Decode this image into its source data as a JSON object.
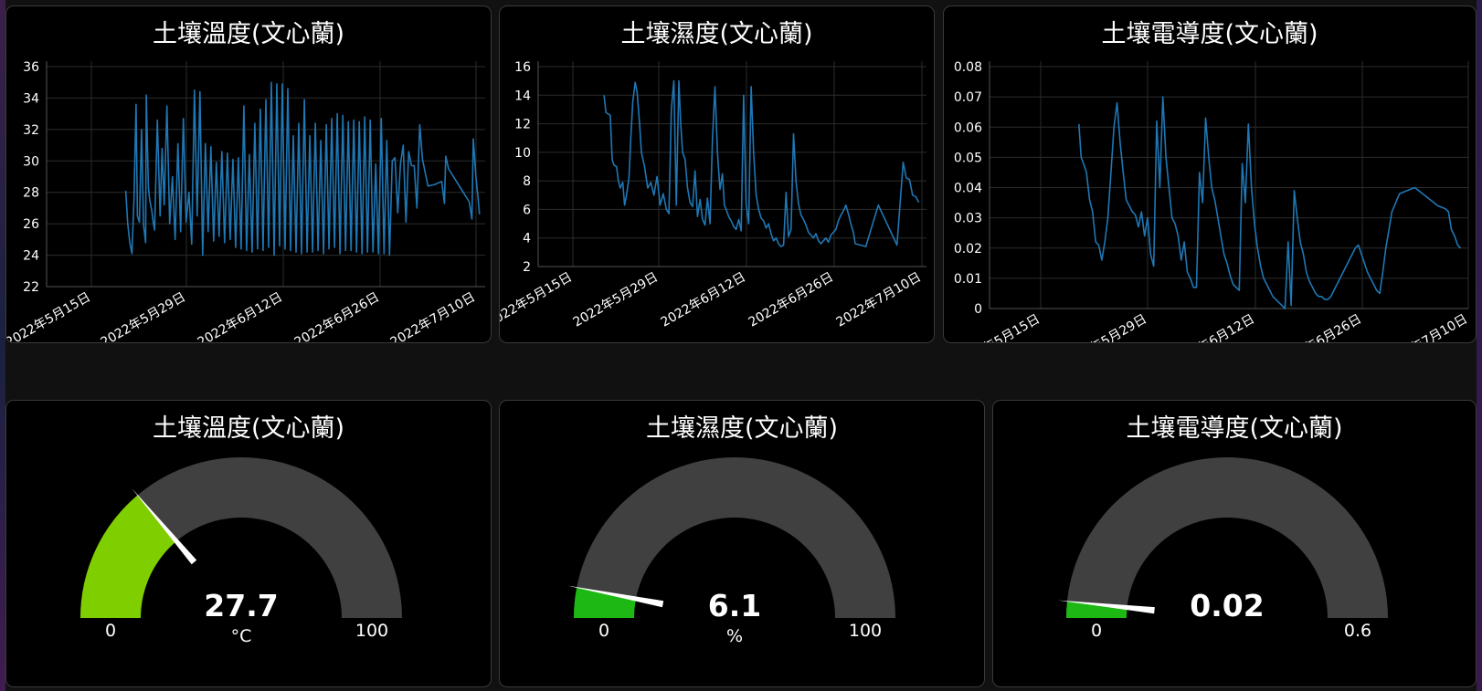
{
  "charts": [
    {
      "title": "土壤溫度(文心蘭)",
      "chart_data": {
        "type": "line",
        "x_start": "2022-05-20",
        "x_ticks": [
          "2022年5月15日",
          "2022年5月29日",
          "2022年6月12日",
          "2022年6月26日",
          "2022年7月10日"
        ],
        "y_ticks": [
          "22",
          "24",
          "26",
          "28",
          "30",
          "32",
          "34",
          "36"
        ],
        "ylim": [
          22,
          36
        ],
        "xlabel": "",
        "ylabel": "",
        "line_color": "#1f77b4",
        "series": [
          {
            "x": [
              0.0,
              0.3,
              0.6,
              0.9,
              1.2,
              1.5,
              1.7,
              2.0,
              2.3,
              2.6,
              2.9,
              3.0,
              3.3,
              3.5,
              3.8,
              4.0,
              4.2,
              4.6,
              5.0,
              5.3,
              5.6,
              6.0,
              6.4,
              6.8,
              7.2,
              7.6,
              8.0,
              8.4,
              8.8,
              9.2,
              9.6,
              10.0,
              10.4,
              10.8,
              11.2,
              11.6,
              12.0,
              12.4,
              12.8,
              13.2,
              13.6,
              14.0,
              14.4,
              14.8,
              15.2,
              15.6,
              16.0,
              16.4,
              16.8,
              17.2,
              17.6,
              18.0,
              18.4,
              18.8,
              19.2,
              19.6,
              20.0,
              20.4,
              20.8,
              21.2,
              21.6,
              22.0,
              22.4,
              22.8,
              23.2,
              23.6,
              24.0,
              24.4,
              24.8,
              25.2,
              25.6,
              26.0,
              26.4,
              26.8,
              27.2,
              27.6,
              28.0,
              28.4,
              28.8,
              29.2,
              29.6,
              30.0,
              30.4,
              30.8,
              31.2,
              31.6,
              32.0,
              32.4,
              32.8,
              33.2,
              33.6,
              34.0,
              34.4,
              34.8,
              35.2,
              35.6,
              36.0,
              36.4,
              36.8,
              37.2,
              37.6,
              38.0,
              38.4,
              38.8,
              39.2,
              39.6,
              40.0,
              40.4,
              40.8,
              41.2,
              41.6,
              42.0,
              42.4,
              42.8,
              43.2,
              44.0,
              45.0,
              46.0,
              46.4,
              46.6,
              47.0,
              50.0,
              50.4,
              50.6,
              51.0,
              51.3,
              51.5
            ],
            "values": [
              28.1,
              26.0,
              24.8,
              24.1,
              27.5,
              33.6,
              26.5,
              26.1,
              32.0,
              25.9,
              24.8,
              34.2,
              28.3,
              27.5,
              26.8,
              26.1,
              25.6,
              32.6,
              26.5,
              30.8,
              27.2,
              33.5,
              26.0,
              29.0,
              25.0,
              31.1,
              25.5,
              32.7,
              26.1,
              28.0,
              24.7,
              34.5,
              26.5,
              34.4,
              24.0,
              31.1,
              25.5,
              30.9,
              24.9,
              29.9,
              25.2,
              30.6,
              24.8,
              30.5,
              25.0,
              30.1,
              24.5,
              30.2,
              24.4,
              33.5,
              24.3,
              30.4,
              24.2,
              32.4,
              24.4,
              33.3,
              24.3,
              33.9,
              24.5,
              35.0,
              24.0,
              34.9,
              24.6,
              34.9,
              24.4,
              34.6,
              24.3,
              31.6,
              24.2,
              32.4,
              24.1,
              33.9,
              24.2,
              31.6,
              24.2,
              32.4,
              24.3,
              31.3,
              24.1,
              32.3,
              24.4,
              32.7,
              24.5,
              33.0,
              24.1,
              32.9,
              24.3,
              32.5,
              24.3,
              32.6,
              24.2,
              32.5,
              24.1,
              32.8,
              24.2,
              32.6,
              24.2,
              29.8,
              24.1,
              32.7,
              24.1,
              31.3,
              24.0,
              30.0,
              30.2,
              26.7,
              29.8,
              31.0,
              26.1,
              30.6,
              29.7,
              29.7,
              27.0,
              32.3,
              30.1,
              28.4,
              28.5,
              28.7,
              27.3,
              30.3,
              29.5,
              27.4,
              26.3,
              31.4,
              28.9,
              27.6,
              26.6
            ]
          }
        ]
      }
    },
    {
      "title": "土壤濕度(文心蘭)",
      "chart_data": {
        "type": "line",
        "x_start": "2022-05-20",
        "x_ticks": [
          "2022年5月15日",
          "2022年5月29日",
          "2022年6月12日",
          "2022年6月26日",
          "2022年7月10日"
        ],
        "y_ticks": [
          "2",
          "4",
          "6",
          "8",
          "10",
          "12",
          "14",
          "16"
        ],
        "ylim": [
          2,
          16
        ],
        "xlabel": "",
        "ylabel": "",
        "line_color": "#1f77b4",
        "series": [
          {
            "x": [
              0.0,
              0.3,
              0.6,
              1.0,
              1.3,
              1.6,
              2.0,
              2.3,
              2.6,
              3.0,
              3.3,
              3.6,
              4.0,
              4.3,
              4.6,
              5.0,
              5.3,
              5.7,
              6.0,
              6.5,
              7.0,
              7.5,
              8.0,
              8.5,
              9.0,
              9.5,
              10.0,
              10.4,
              10.8,
              11.2,
              11.6,
              12.0,
              12.3,
              12.6,
              13.0,
              13.4,
              13.8,
              14.2,
              14.6,
              15.0,
              15.4,
              15.8,
              16.2,
              16.6,
              17.0,
              17.4,
              17.8,
              18.2,
              18.6,
              19.0,
              19.3,
              19.6,
              20.0,
              20.4,
              20.8,
              21.2,
              21.6,
              22.0,
              22.4,
              22.8,
              23.2,
              23.6,
              24.0,
              24.4,
              24.8,
              25.2,
              25.6,
              26.0,
              26.4,
              26.8,
              27.2,
              27.6,
              28.0,
              28.4,
              28.8,
              29.2,
              29.6,
              30.0,
              30.4,
              30.8,
              31.2,
              31.6,
              32.0,
              32.4,
              32.8,
              33.2,
              33.6,
              34.0,
              34.4,
              34.8,
              35.2,
              35.6,
              36.0,
              36.4,
              36.8,
              37.2,
              37.6,
              38.0,
              38.4,
              38.8,
              39.2,
              39.6,
              40.0,
              40.3,
              42.0,
              44.0,
              47.0,
              48.0,
              48.5,
              49.0,
              49.5,
              50.0,
              50.5
            ],
            "values": [
              14.0,
              12.8,
              12.7,
              12.6,
              9.5,
              9.1,
              9.0,
              8.0,
              7.5,
              7.9,
              6.3,
              7.0,
              8.2,
              11.0,
              13.5,
              14.9,
              14.2,
              12.0,
              10.0,
              9.0,
              7.5,
              7.9,
              7.0,
              8.3,
              6.3,
              7.1,
              6.0,
              5.7,
              13.0,
              15.0,
              6.3,
              15.0,
              12.0,
              10.0,
              9.5,
              7.5,
              6.5,
              6.2,
              8.7,
              5.5,
              6.7,
              5.3,
              4.9,
              6.8,
              5.0,
              11.0,
              14.6,
              9.9,
              7.4,
              8.5,
              6.3,
              6.0,
              5.5,
              5.2,
              4.8,
              4.6,
              5.3,
              4.5,
              14.0,
              6.4,
              5.0,
              14.6,
              10.0,
              7.0,
              6.0,
              5.4,
              5.2,
              4.7,
              5.0,
              4.3,
              3.8,
              4.0,
              3.6,
              3.4,
              3.5,
              7.2,
              4.1,
              4.6,
              11.3,
              8.0,
              6.4,
              5.6,
              5.3,
              4.9,
              4.4,
              4.2,
              4.0,
              4.3,
              3.8,
              3.6,
              3.8,
              4.0,
              3.7,
              4.2,
              4.4,
              4.6,
              5.2,
              5.6,
              5.9,
              6.3,
              5.7,
              5.0,
              4.4,
              3.6,
              3.4,
              6.3,
              3.5,
              9.3,
              8.2,
              8.1,
              7.0,
              6.9,
              6.5,
              6.3
            ]
          }
        ]
      }
    },
    {
      "title": "土壤電導度(文心蘭)",
      "chart_data": {
        "type": "line",
        "x_start": "2022-05-20",
        "x_ticks": [
          "2022年5月15日",
          "2022年5月29日",
          "2022年6月12日",
          "2022年6月26日",
          "2022年7月10日"
        ],
        "y_ticks": [
          "0",
          "0.01",
          "0.02",
          "0.03",
          "0.04",
          "0.05",
          "0.06",
          "0.07",
          "0.08"
        ],
        "ylim": [
          0,
          0.08
        ],
        "xlabel": "",
        "ylabel": "",
        "line_color": "#1f77b4",
        "series": [
          {
            "x": [
              0.0,
              0.3,
              0.6,
              1.0,
              1.4,
              1.8,
              2.2,
              2.6,
              3.0,
              3.4,
              3.8,
              4.2,
              4.6,
              5.0,
              5.4,
              5.8,
              6.2,
              6.6,
              7.0,
              7.4,
              7.8,
              8.2,
              8.6,
              9.0,
              9.4,
              9.8,
              10.2,
              10.6,
              11.0,
              11.4,
              11.8,
              12.2,
              12.6,
              13.0,
              13.4,
              13.8,
              14.2,
              14.6,
              15.0,
              15.4,
              15.8,
              16.2,
              16.6,
              17.0,
              17.4,
              17.8,
              18.2,
              18.6,
              19.0,
              19.4,
              19.8,
              20.2,
              20.6,
              21.0,
              21.4,
              21.8,
              22.2,
              22.6,
              23.0,
              23.4,
              23.8,
              24.2,
              24.6,
              25.0,
              25.4,
              25.8,
              26.2,
              26.6,
              27.0,
              27.4,
              27.8,
              28.2,
              28.6,
              29.0,
              29.4,
              29.8,
              30.2,
              30.6,
              31.0,
              31.4,
              31.8,
              32.2,
              32.6,
              33.0,
              33.4,
              33.8,
              34.2,
              34.6,
              35.0,
              35.4,
              35.8,
              36.2,
              36.6,
              37.0,
              37.4,
              37.8,
              38.2,
              38.6,
              39.0,
              39.4,
              39.8,
              40.2,
              40.6,
              41.0,
              42.0,
              44.0,
              47.0,
              48.0,
              48.4,
              48.8,
              49.2,
              49.6,
              50.0,
              50.4
            ],
            "values": [
              0.061,
              0.05,
              0.048,
              0.045,
              0.036,
              0.032,
              0.022,
              0.021,
              0.016,
              0.022,
              0.03,
              0.045,
              0.06,
              0.068,
              0.055,
              0.045,
              0.036,
              0.034,
              0.032,
              0.031,
              0.027,
              0.032,
              0.024,
              0.03,
              0.018,
              0.014,
              0.062,
              0.04,
              0.07,
              0.05,
              0.04,
              0.03,
              0.028,
              0.024,
              0.016,
              0.022,
              0.012,
              0.01,
              0.007,
              0.007,
              0.045,
              0.035,
              0.063,
              0.05,
              0.04,
              0.036,
              0.03,
              0.024,
              0.018,
              0.015,
              0.011,
              0.008,
              0.007,
              0.006,
              0.048,
              0.035,
              0.061,
              0.04,
              0.028,
              0.02,
              0.014,
              0.01,
              0.008,
              0.006,
              0.004,
              0.003,
              0.002,
              0.001,
              0.0,
              0.022,
              0.001,
              0.039,
              0.03,
              0.022,
              0.018,
              0.012,
              0.009,
              0.007,
              0.005,
              0.004,
              0.004,
              0.003,
              0.003,
              0.004,
              0.006,
              0.008,
              0.01,
              0.012,
              0.014,
              0.016,
              0.018,
              0.02,
              0.021,
              0.018,
              0.015,
              0.012,
              0.01,
              0.008,
              0.006,
              0.005,
              0.012,
              0.02,
              0.026,
              0.032,
              0.038,
              0.04,
              0.034,
              0.033,
              0.032,
              0.026,
              0.024,
              0.021,
              0.02
            ]
          }
        ]
      }
    }
  ],
  "gauges": [
    {
      "title": "土壤溫度(文心蘭)",
      "value": "27.7",
      "value_num": 27.7,
      "unit": "°C",
      "min": "0",
      "max": "100",
      "min_num": 0,
      "max_num": 100,
      "fill_color": "#7fce00"
    },
    {
      "title": "土壤濕度(文心蘭)",
      "value": "6.1",
      "value_num": 6.1,
      "unit": "%",
      "min": "0",
      "max": "100",
      "min_num": 0,
      "max_num": 100,
      "fill_color": "#1db814"
    },
    {
      "title": "土壤電導度(文心蘭)",
      "value": "0.02",
      "value_num": 0.02,
      "unit": "",
      "min": "0",
      "max": "0.6",
      "min_num": 0,
      "max_num": 0.6,
      "fill_color": "#1db814"
    }
  ]
}
